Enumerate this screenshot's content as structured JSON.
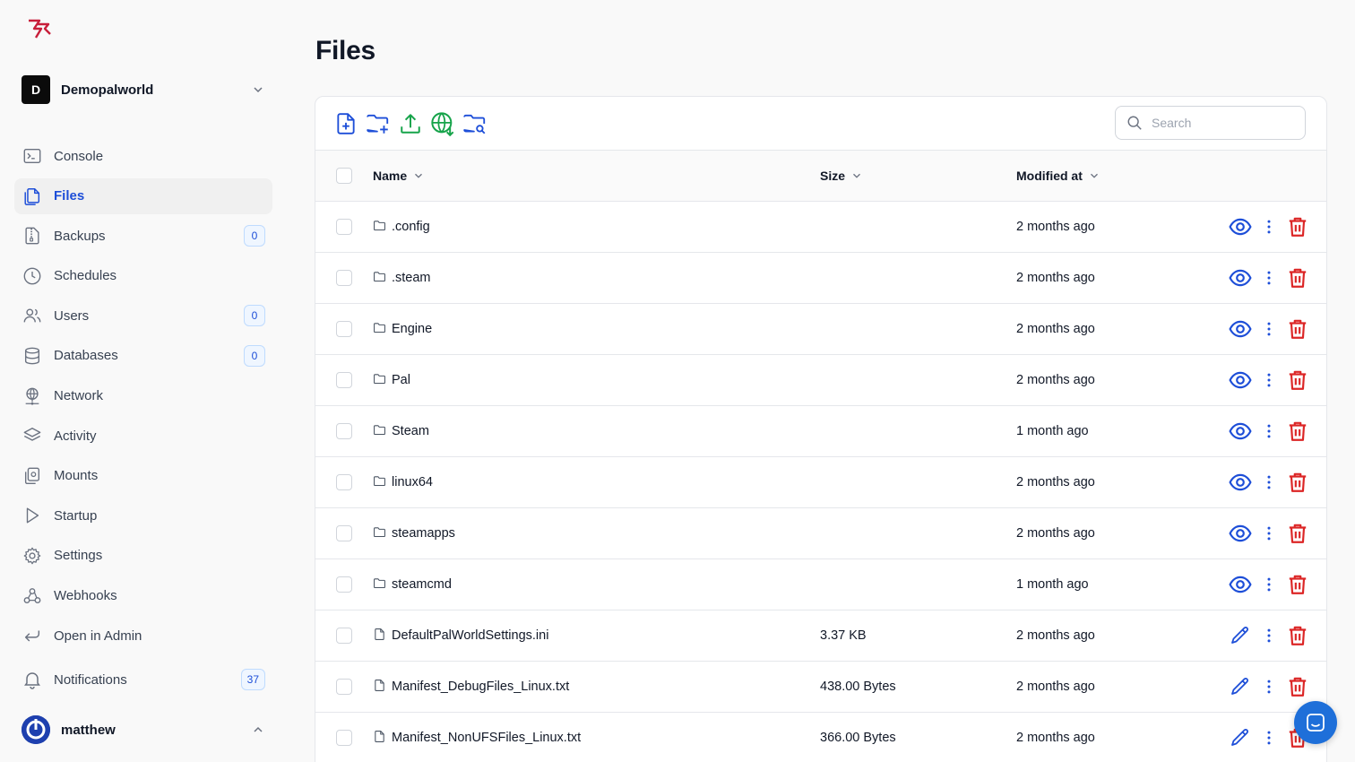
{
  "server": {
    "initial": "D",
    "name": "Demopalworld"
  },
  "nav": [
    {
      "label": "Console",
      "icon": "terminal-icon",
      "badge": null,
      "active": false
    },
    {
      "label": "Files",
      "icon": "files-icon",
      "badge": null,
      "active": true
    },
    {
      "label": "Backups",
      "icon": "archive-icon",
      "badge": "0",
      "active": false
    },
    {
      "label": "Schedules",
      "icon": "clock-icon",
      "badge": null,
      "active": false
    },
    {
      "label": "Users",
      "icon": "users-icon",
      "badge": "0",
      "active": false
    },
    {
      "label": "Databases",
      "icon": "database-icon",
      "badge": "0",
      "active": false
    },
    {
      "label": "Network",
      "icon": "network-icon",
      "badge": null,
      "active": false
    },
    {
      "label": "Activity",
      "icon": "layers-icon",
      "badge": null,
      "active": false
    },
    {
      "label": "Mounts",
      "icon": "mounts-icon",
      "badge": null,
      "active": false
    },
    {
      "label": "Startup",
      "icon": "play-icon",
      "badge": null,
      "active": false
    },
    {
      "label": "Settings",
      "icon": "gear-icon",
      "badge": null,
      "active": false
    },
    {
      "label": "Webhooks",
      "icon": "webhook-icon",
      "badge": null,
      "active": false
    },
    {
      "label": "Open in Admin",
      "icon": "return-icon",
      "badge": null,
      "active": false
    }
  ],
  "notifications": {
    "label": "Notifications",
    "count": "37"
  },
  "user": {
    "name": "matthew"
  },
  "page": {
    "title": "Files"
  },
  "search": {
    "placeholder": "Search"
  },
  "columns": {
    "name": "Name",
    "size": "Size",
    "modified": "Modified at"
  },
  "files": [
    {
      "name": ".config",
      "type": "folder",
      "size": "",
      "modified": "2 months ago"
    },
    {
      "name": ".steam",
      "type": "folder",
      "size": "",
      "modified": "2 months ago"
    },
    {
      "name": "Engine",
      "type": "folder",
      "size": "",
      "modified": "2 months ago"
    },
    {
      "name": "Pal",
      "type": "folder",
      "size": "",
      "modified": "2 months ago"
    },
    {
      "name": "Steam",
      "type": "folder",
      "size": "",
      "modified": "1 month ago"
    },
    {
      "name": "linux64",
      "type": "folder",
      "size": "",
      "modified": "2 months ago"
    },
    {
      "name": "steamapps",
      "type": "folder",
      "size": "",
      "modified": "2 months ago"
    },
    {
      "name": "steamcmd",
      "type": "folder",
      "size": "",
      "modified": "1 month ago"
    },
    {
      "name": "DefaultPalWorldSettings.ini",
      "type": "file",
      "size": "3.37 KB",
      "modified": "2 months ago"
    },
    {
      "name": "Manifest_DebugFiles_Linux.txt",
      "type": "file",
      "size": "438.00 Bytes",
      "modified": "2 months ago"
    },
    {
      "name": "Manifest_NonUFSFiles_Linux.txt",
      "type": "file",
      "size": "366.00 Bytes",
      "modified": "2 months ago"
    }
  ],
  "colors": {
    "accent": "#1d4ed8",
    "danger": "#dc2626",
    "success": "#16a34a",
    "logo": "#c81e3a"
  }
}
